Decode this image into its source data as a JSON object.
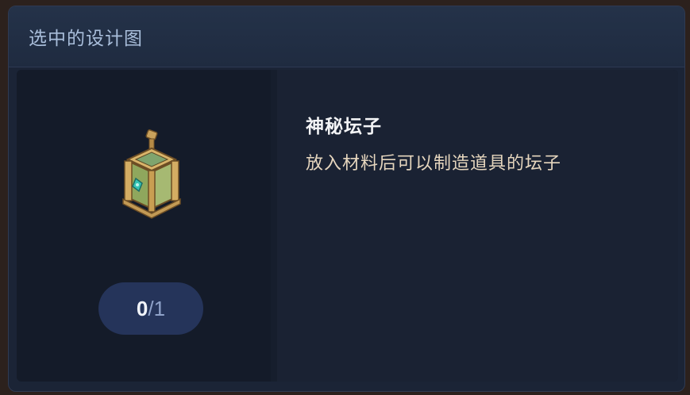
{
  "header": {
    "title": "选中的设计图"
  },
  "item": {
    "icon": "mystic-urn-icon",
    "count_have": "0",
    "count_separator": "/",
    "count_need": "1",
    "name": "神秘坛子",
    "description": "放入材料后可以制造道具的坛子"
  },
  "colors": {
    "panel": "#1b2436",
    "header_text": "#a9bedb",
    "pill": "#25345a",
    "description_text": "#e6d6be"
  }
}
